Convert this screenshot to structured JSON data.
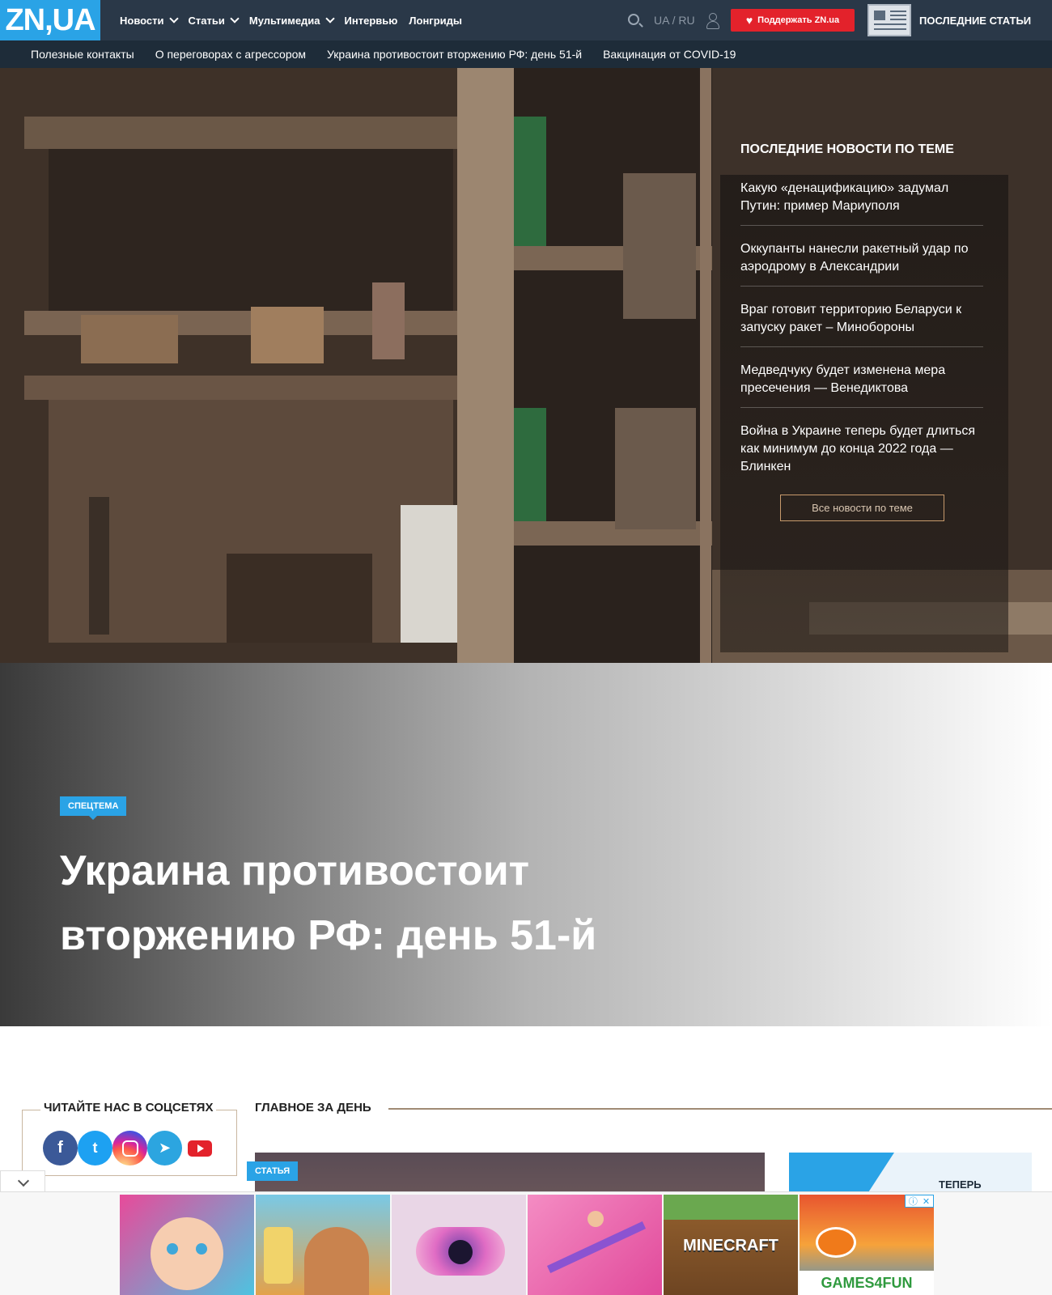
{
  "header": {
    "logo": "ZN,UA",
    "nav": [
      {
        "label": "Новости",
        "has_dropdown": true
      },
      {
        "label": "Статьи",
        "has_dropdown": true
      },
      {
        "label": "Мультимедиа",
        "has_dropdown": true
      },
      {
        "label": "Интервью",
        "has_dropdown": false
      },
      {
        "label": "Лонгриды",
        "has_dropdown": false
      }
    ],
    "lang_ua": "UA",
    "lang_sep": "/",
    "lang_ru": "RU",
    "support_label": "Поддержать ZN.ua",
    "latest_label": "ПОСЛЕДНИЕ СТАТЬИ"
  },
  "subnav": [
    "Полезные контакты",
    "О переговорах с агрессором",
    "Украина противостоит вторжению РФ: день 51-й",
    "Вакцинация от COVID-19"
  ],
  "hero": {
    "panel_title": "ПОСЛЕДНИЕ НОВОСТИ ПО ТЕМЕ",
    "news": [
      "Какую «денацификацию» задумал Путин: пример Мариуполя",
      "Оккупанты нанесли ракетный удар по аэродрому в Александрии",
      "Враг готовит территорию Беларуси к запуску ракет – Минобороны",
      "Медведчуку будет изменена мера пресечения — Венедиктова",
      "Война в Украине теперь будет длиться как минимум до конца 2022 года — Блинкен"
    ],
    "all_news_label": "Все новости по теме"
  },
  "article": {
    "tag": "СПЕЦТЕМА",
    "title": "Украина противостоит вторжению РФ: день 51-й"
  },
  "social": {
    "title": "ЧИТАЙТЕ НАС В СОЦСЕТЯХ",
    "icons": [
      "facebook-icon",
      "twitter-icon",
      "instagram-icon",
      "telegram-icon",
      "youtube-icon"
    ]
  },
  "main_day": {
    "title": "ГЛАВНОЕ ЗА ДЕНЬ",
    "article_tag": "СТАТЬЯ",
    "promo_text": "ТЕПЕРЬ"
  },
  "ads": {
    "tiles": [
      "",
      "",
      "",
      "",
      "MINECRAFT",
      "GAMES4FUN"
    ]
  },
  "colors": {
    "brand_blue": "#2aa3e6",
    "header_dark": "#2a3848",
    "support_red": "#e3222b"
  }
}
